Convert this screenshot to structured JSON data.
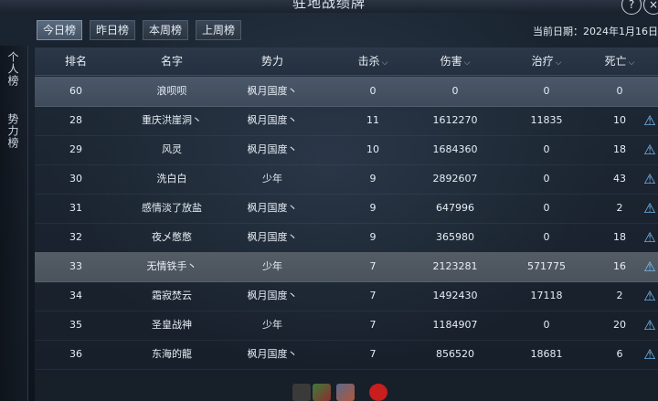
{
  "window": {
    "title": "驻地战绩牌",
    "help_label": "?",
    "close_label": "×"
  },
  "tabs": [
    {
      "label": "今日榜",
      "active": true
    },
    {
      "label": "昨日榜",
      "active": false
    },
    {
      "label": "本周榜",
      "active": false
    },
    {
      "label": "上周榜",
      "active": false
    }
  ],
  "date_text": "当前日期：2024年1月16日",
  "side_tabs": [
    "个人榜",
    "势力榜"
  ],
  "columns": [
    "排名",
    "名字",
    "势力",
    "击杀",
    "伤害",
    "治疗",
    "死亡"
  ],
  "sortable_columns": [
    "击杀",
    "伤害",
    "治疗",
    "死亡"
  ],
  "rows": [
    {
      "rank": "60",
      "name": "浪呗呗",
      "faction": "枫月国度丶",
      "kills": "0",
      "damage": "0",
      "heal": "0",
      "deaths": "0",
      "type": "self",
      "report": false
    },
    {
      "rank": "28",
      "name": "重庆洪崖洞丶",
      "faction": "枫月国度丶",
      "kills": "11",
      "damage": "1612270",
      "heal": "11835",
      "deaths": "10",
      "type": "normal",
      "report": true
    },
    {
      "rank": "29",
      "name": "风灵",
      "faction": "枫月国度丶",
      "kills": "10",
      "damage": "1684360",
      "heal": "0",
      "deaths": "18",
      "type": "normal",
      "report": true
    },
    {
      "rank": "30",
      "name": "洗白白",
      "faction": "少年",
      "kills": "9",
      "damage": "2892607",
      "heal": "0",
      "deaths": "43",
      "type": "normal",
      "report": true
    },
    {
      "rank": "31",
      "name": "感情淡了放盐",
      "faction": "枫月国度丶",
      "kills": "9",
      "damage": "647996",
      "heal": "0",
      "deaths": "2",
      "type": "normal",
      "report": true
    },
    {
      "rank": "32",
      "name": "夜乄憋憋",
      "faction": "枫月国度丶",
      "kills": "9",
      "damage": "365980",
      "heal": "0",
      "deaths": "18",
      "type": "normal",
      "report": true
    },
    {
      "rank": "33",
      "name": "无情铁手丶",
      "faction": "少年",
      "kills": "7",
      "damage": "2123281",
      "heal": "571775",
      "deaths": "16",
      "type": "highlight",
      "report": true
    },
    {
      "rank": "34",
      "name": "霜寂焚云",
      "faction": "枫月国度丶",
      "kills": "7",
      "damage": "1492430",
      "heal": "17118",
      "deaths": "2",
      "type": "normal",
      "report": true
    },
    {
      "rank": "35",
      "name": "圣皇战神",
      "faction": "少年",
      "kills": "7",
      "damage": "1184907",
      "heal": "0",
      "deaths": "20",
      "type": "normal",
      "report": true
    },
    {
      "rank": "36",
      "name": "东海的龍",
      "faction": "枫月国度丶",
      "kills": "7",
      "damage": "856520",
      "heal": "18681",
      "deaths": "6",
      "type": "normal",
      "report": true
    }
  ],
  "report_icon_glyph": "⚠",
  "sort_icon_glyph": "⌵",
  "colors": {
    "accent_icon": "#7ec5ff",
    "self_row": "#4b5869",
    "highlight_row": "#545c66"
  }
}
